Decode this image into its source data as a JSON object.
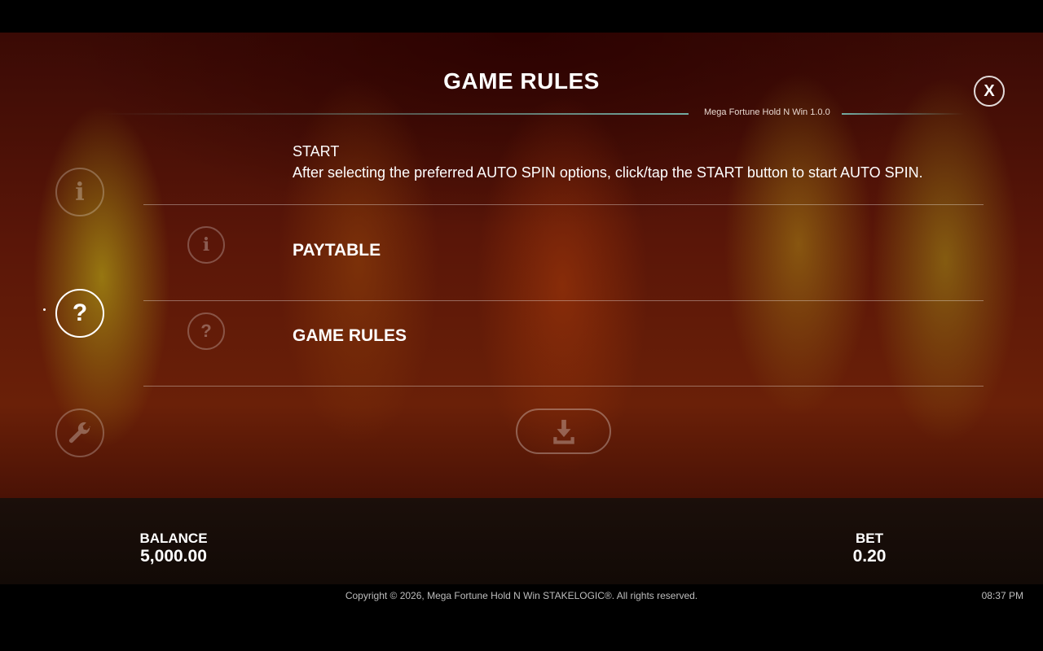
{
  "header": {
    "title": "GAME RULES",
    "version": "Mega Fortune Hold N Win 1.0.0",
    "close_label": "X"
  },
  "sidebar": {
    "items": [
      {
        "name": "info",
        "glyph": "i",
        "active": false
      },
      {
        "name": "help",
        "glyph": "?",
        "active": true
      },
      {
        "name": "settings",
        "glyph": "wrench",
        "active": false
      }
    ]
  },
  "content": {
    "start_title": "START",
    "start_desc": "After selecting the preferred AUTO SPIN options, click/tap the START button to start AUTO SPIN.",
    "rows": [
      {
        "label": "PAYTABLE",
        "glyph": "i"
      },
      {
        "label": "GAME RULES",
        "glyph": "?"
      }
    ]
  },
  "status": {
    "balance_label": "BALANCE",
    "balance_value": "5,000.00",
    "bet_label": "BET",
    "bet_value": "0.20"
  },
  "footer": {
    "copyright": "Copyright © 2026, Mega Fortune Hold N Win STAKELOGIC®. All rights reserved.",
    "time": "08:37 PM"
  }
}
